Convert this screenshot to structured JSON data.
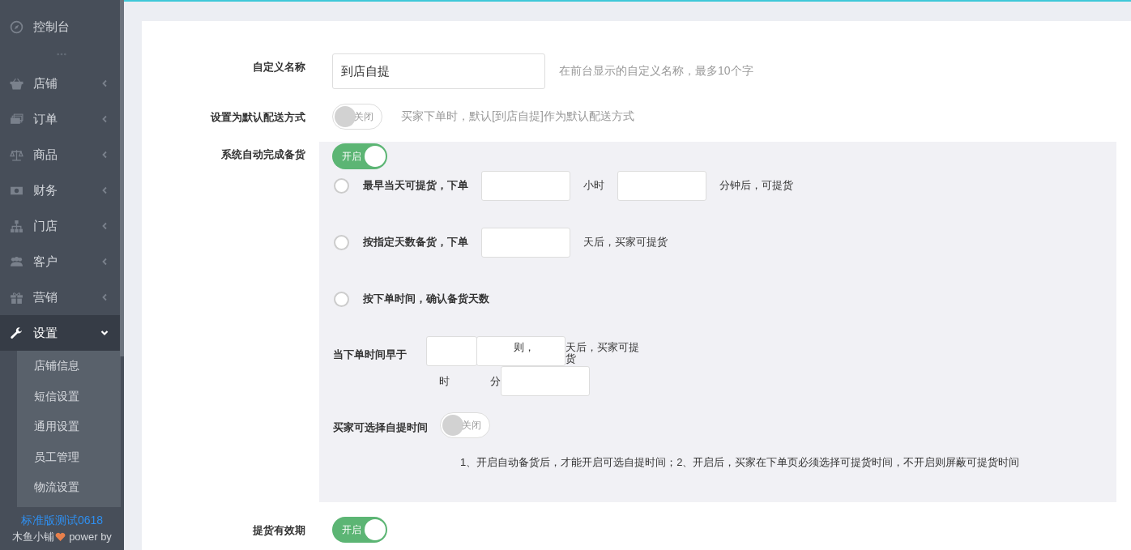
{
  "sidebar": {
    "items": [
      {
        "label": "控制台",
        "kind": "link",
        "selected": false
      },
      {
        "label": "店铺",
        "kind": "menu",
        "selected": false,
        "expanded": false
      },
      {
        "label": "订单",
        "kind": "menu",
        "selected": false,
        "expanded": false
      },
      {
        "label": "商品",
        "kind": "menu",
        "selected": false,
        "expanded": false
      },
      {
        "label": "财务",
        "kind": "menu",
        "selected": false,
        "expanded": false
      },
      {
        "label": "门店",
        "kind": "menu",
        "selected": false,
        "expanded": false
      },
      {
        "label": "客户",
        "kind": "menu",
        "selected": false,
        "expanded": false
      },
      {
        "label": "营销",
        "kind": "menu",
        "selected": false,
        "expanded": false
      },
      {
        "label": "设置",
        "kind": "menu",
        "selected": true,
        "expanded": true,
        "children": [
          {
            "label": "店铺信息",
            "selected": false
          },
          {
            "label": "短信设置",
            "selected": false
          },
          {
            "label": "通用设置",
            "selected": false
          },
          {
            "label": "员工管理",
            "selected": false
          },
          {
            "label": "物流设置",
            "selected": false
          }
        ]
      }
    ],
    "footer": {
      "title": "标准版测试0618",
      "brand": "木鱼小铺",
      "power": "power by"
    }
  },
  "form": {
    "rows": [
      {
        "label": "自定义名称",
        "kind": "text",
        "value": "到店自提",
        "hint": "在前台显示的自定义名称，最多10个字"
      },
      {
        "label": "设置为默认配送方式",
        "kind": "switch",
        "on": false,
        "switch_text": "关闭",
        "hint": "买家下单时，默认[到店自提]作为默认配送方式"
      },
      {
        "label": "系统自动完成备货",
        "kind": "switch",
        "on": true,
        "switch_text": "开启",
        "panel": {
          "options": [
            {
              "label": "最早当天可提货，下单",
              "selected": false,
              "parts": [
                {
                  "kind": "field"
                },
                {
                  "kind": "text",
                  "text": "小时"
                },
                {
                  "kind": "field"
                },
                {
                  "kind": "text",
                  "text": "分钟后，可提货"
                }
              ]
            },
            {
              "label": "按指定天数备货，下单",
              "selected": false,
              "parts": [
                {
                  "kind": "field"
                },
                {
                  "kind": "text",
                  "text": "天后，买家可提货"
                }
              ]
            },
            {
              "label": "按下单时间，确认备货天数",
              "selected": false
            }
          ],
          "time_rule": {
            "label": "当下单时间早于",
            "hour_unit": "时",
            "minute_unit": "分",
            "then": "则，",
            "suffix": "天后，买家可提货"
          },
          "pick_time": {
            "label": "买家可选择自提时间",
            "on": false,
            "switch_text": "关闭"
          },
          "note": "1、开启自动备货后，才能开启可选自提时间；2、开启后，买家在下单页必须选择可提货时间，不开启则屏蔽可提货时间"
        }
      },
      {
        "label": "提货有效期",
        "kind": "switch",
        "on": true,
        "switch_text": "开启"
      }
    ]
  }
}
